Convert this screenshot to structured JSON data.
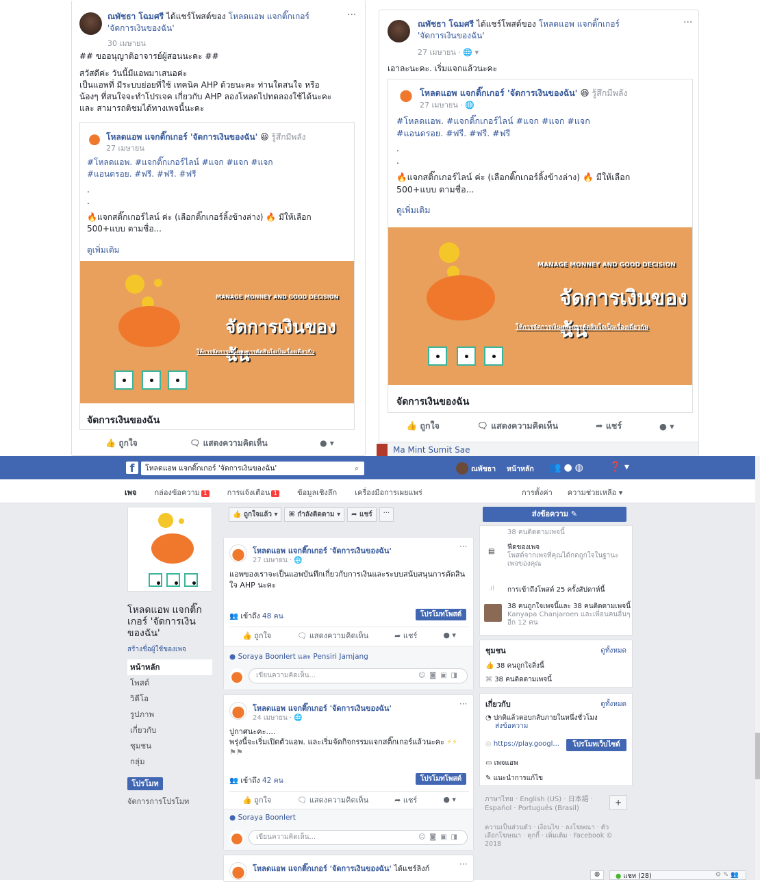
{
  "post_left": {
    "author": "ณพัชธา โฉมศรี",
    "shared_text": "ได้แชร์โพสต์ของ",
    "page_name": "โหลดแอพ แจกติ๊กเกอร์",
    "page_quote": "'จัดการเงินของฉัน'",
    "date": "30 เมษายน",
    "line1": "## ขออนุญาติอาจารย์ผู้สอนนะคะ ##",
    "line2": "สวัสดีค่ะ วันนี้มีแอพมาเสนอค่ะ",
    "line3": "เป็นแอพที่ มีระบบย่อยที่ใช้ เทคนิค AHP ด้วยนะคะ ท่านใดสนใจ หรือ",
    "line4": "น้องๆ ที่สนใจจะทำโปรเจค เกี่ยวกับ AHP ลองโหลดไปทดลองใช้ได้นะคะ",
    "line5": "และ สามารถติชมได้ทางเพจนี้นะคะ",
    "inner_name": "โหลดแอพ แจกติ๊กเกอร์ 'จัดการเงินของฉัน'",
    "inner_feeling": "รู้สึกมีพลัง",
    "inner_date": "27 เมษายน",
    "tags1": "#โหลดแอพ. #แจกติ๊กเกอร์ไลน์ #แจก #แจก #แจก",
    "tags2": "#แอนดรอย. #ฟรี. #ฟรี. #ฟรี",
    "dot1": ".",
    "dot2": ".",
    "fire_text": "แจกสติ๊กเกอร์ไลน์ ค่ะ (เลือกติ๊กเกอร์ลิ้งข้างล่าง)",
    "fire_text2": "มีให้เลือก",
    "more_line": "500+แบบ ตามชื่อ...",
    "see_more": "ดูเพิ่มเติม",
    "banner_small": "MANAGE MONNEY AND GOOD DECISION",
    "banner_big": "จัดการเงินของฉัน",
    "banner_sub": "ให้การจัดการเงินและการตัดสินใจเป็นเรื่องเดียวกัน",
    "caption": "จัดการเงินของฉัน",
    "like": "ถูกใจ",
    "comment": "แสดงความคิดเห็น"
  },
  "post_right": {
    "author": "ณพัชธา โฉมศรี",
    "shared_text": "ได้แชร์โพสต์ของ",
    "page_name": "โหลดแอพ แจกติ๊กเกอร์",
    "page_quote": "'จัดการเงินของฉัน'",
    "date": "27 เมษายน · ",
    "body": "เอาละนะคะ. เริ่มแจกแล้วนะคะ",
    "inner_name": "โหลดแอพ แจกติ๊กเกอร์ 'จัดการเงินของฉัน'",
    "inner_feeling": "รู้สึกมีพลัง",
    "inner_date": "27 เมษายน · ",
    "tags1": "#โหลดแอพ. #แจกติ๊กเกอร์ไลน์ #แจก #แจก #แจก",
    "tags2": "#แอนดรอย. #ฟรี. #ฟรี. #ฟรี",
    "dot1": ".",
    "dot2": ".",
    "fire_text": "แจกสติ๊กเกอร์ไลน์ ค่ะ (เลือกติ๊กเกอร์ลิ้งข้างล่าง)",
    "fire_text2": "มีให้เลือก",
    "more_line": "500+แบบ ตามชื่อ...",
    "see_more": "ดูเพิ่มเติม",
    "banner_small": "MANAGE MONNEY AND GOOD DECISION",
    "banner_big": "จัดการเงินของฉัน",
    "banner_sub": "ให้การจัดการเงินและการตัดสินใจเป็นเรื่องเดียวกัน",
    "caption": "จัดการเงินของฉัน",
    "like": "ถูกใจ",
    "comment": "แสดงความคิดเห็น",
    "share": "แชร์",
    "commenter": "Ma Mint Sumit Sae"
  },
  "topbar": {
    "search_value": "โหลดแอพ แจกติ๊กเกอร์ 'จัดการเงินของฉัน'",
    "user": "ณพัชธา",
    "home": "หน้าหลัก"
  },
  "subnav": {
    "page": "เพจ",
    "inbox": "กล่องข้อความ",
    "inbox_count": "1",
    "notif": "การแจ้งเตือน",
    "notif_count": "1",
    "insights": "ข้อมูลเชิงลึก",
    "tools": "เครื่องมือการเผยแพร่",
    "settings": "การตั้งค่า",
    "help": "ความช่วยเหลือ ▾"
  },
  "page_sidebar": {
    "title": "โหลดแอพ แจกติ๊ก เกอร์ 'จัดการเงิน ของฉัน'",
    "create_username": "สร้างชื่อผู้ใช้ของเพจ",
    "items": [
      "หน้าหลัก",
      "โพสต์",
      "วิดีโอ",
      "รูปภาพ",
      "เกี่ยวกับ",
      "ชุมชน",
      "กลุ่ม"
    ],
    "promote": "โปรโมท",
    "manage_promo": "จัดการการโปรโมท"
  },
  "action_bar": {
    "liked": "ถูกใจแล้ว ▾",
    "following": "กำลังติดตาม ▾",
    "share": "แชร์",
    "more": "···",
    "send_msg": "ส่งข้อความ ✎"
  },
  "feed_post1": {
    "name": "โหลดแอพ แจกติ๊กเกอร์ 'จัดการเงินของฉัน'",
    "date": "27 เมษายน · ",
    "body": "แอพของเราจะเป็นแอพบันทึกเกี่ยวกับการเงินและระบบสนับสนุนการตัดสินใจ AHP นะคะ",
    "reach": "เข้าถึง",
    "reach_count": "48 คน",
    "promote": "โปรโมทโพสต์",
    "like": "ถูกใจ",
    "comment": "แสดงความคิดเห็น",
    "share": "แชร์",
    "likers": "Soraya Boonlert และ Pensiri Jamjang",
    "write": "เขียนความคิดเห็น..."
  },
  "feed_post2": {
    "name": "โหลดแอพ แจกติ๊กเกอร์ 'จัดการเงินของฉัน'",
    "date": "24 เมษายน · ",
    "body1": "ปูกาศนะคะ....",
    "body2": "พรุ่งนี้จะเริ่มเปิดตัวแอพ. และเริ่มจัดกิจกรรมแจกสติ๊กเกอร์แล้วนะคะ",
    "reach": "เข้าถึง",
    "reach_count": "42 คน",
    "promote": "โปรโมทโพสต์",
    "like": "ถูกใจ",
    "comment": "แสดงความคิดเห็น",
    "share": "แชร์",
    "likers": "Soraya Boonlert",
    "write": "เขียนความคิดเห็น..."
  },
  "feed_post3": {
    "name": "โหลดแอพ แจกติ๊กเกอร์ 'จัดการเงินของฉัน'",
    "extra": "ได้แชร์ลิงก์"
  },
  "right_col": {
    "followers_top": "38 คนติดตามเพจนี้",
    "pagefeed_title": "ฟีดของเพจ",
    "pagefeed_desc": "โพสต์จากเพจที่คุณได้กดถูกใจในฐานะเพจของคุณ",
    "post_reach": "การเข้าถึงโพสต์ 25 ครั้งสัปดาห์นี้",
    "likes_summary": "38 คนถูกใจเพจนี้และ 38 คนติดตามเพจนี้",
    "friend_line": "Kanyapa Chanjaroen และเพื่อนคนอื่นๆ อีก 12 คน",
    "community": "ชุมชน",
    "see_all": "ดูทั้งหมด",
    "likes": "38 คนถูกใจสิ่งนี้",
    "follows": "38 คนติดตามเพจนี้",
    "about": "เกี่ยวกับ",
    "reply": "ปกติแล้วตอบกลับภายในหนึ่งชั่วโมง",
    "send_msg": "ส่งข้อความ",
    "url": "https://play.googl...",
    "promote_web": "โปรโมทเว็บไซต์",
    "app_page": "เพจแอพ",
    "suggest": "แนะนำการแก้ไข",
    "langs": "ภาษาไทย · English (US) · 日本語 · Español · Português (Brasil)",
    "footer": "ความเป็นส่วนตัว · เงื่อนไข · ลงโฆษณา · ตัวเลือกโฆษณา · คุกกี้ · เพิ่มเติม · Facebook © 2018"
  },
  "chat": {
    "label": "แชท (28)"
  },
  "colors": {
    "fb_blue": "#4267b2",
    "link": "#365899",
    "banner_bg": "#e8a05c",
    "pig": "#f0782d",
    "coin": "#f5c62a",
    "teal": "#39b59c"
  }
}
